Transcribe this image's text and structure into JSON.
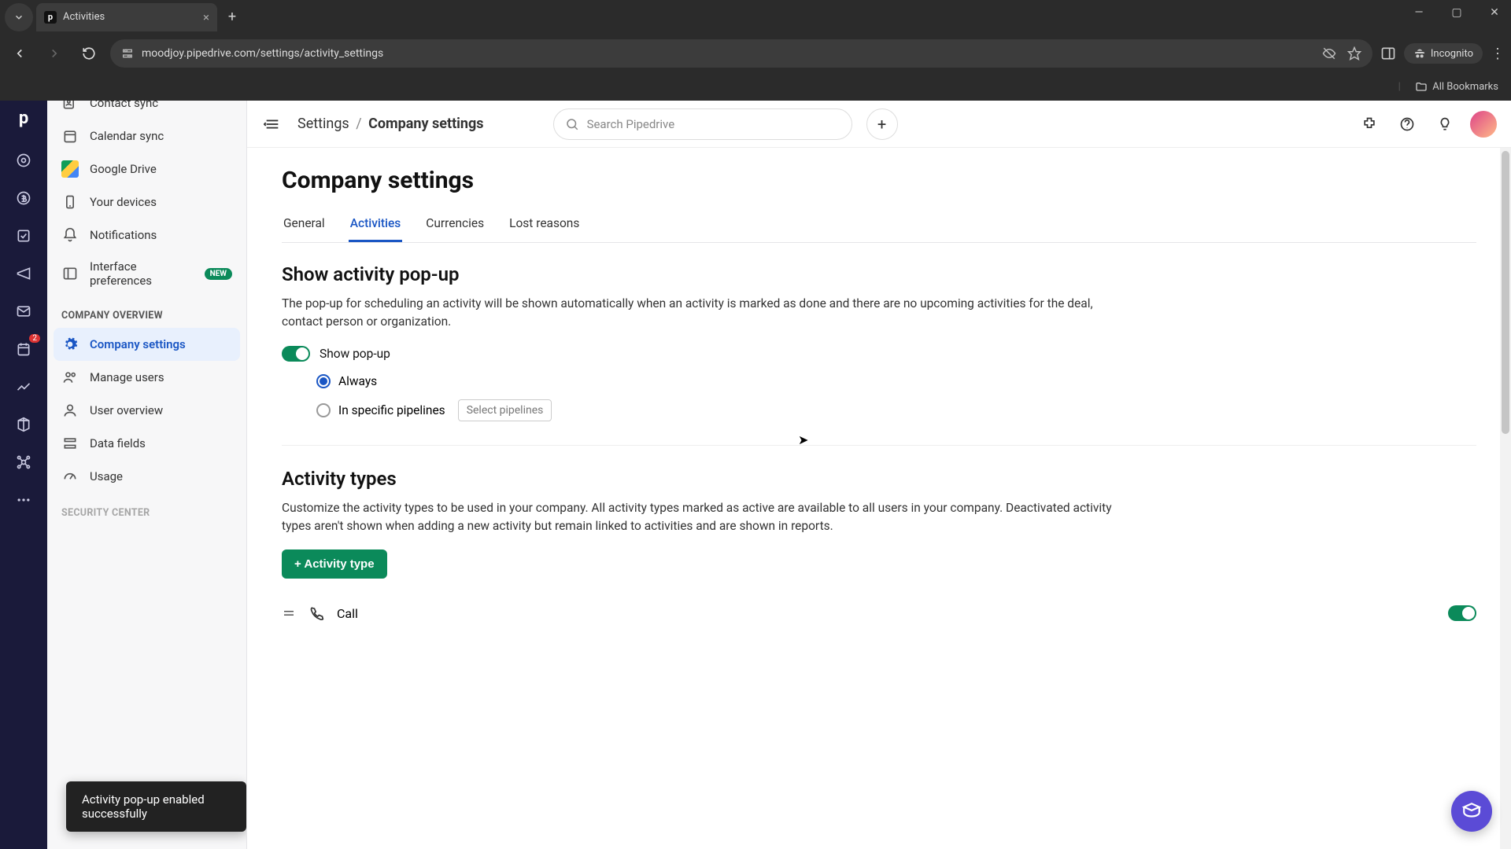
{
  "browser": {
    "tab_title": "Activities",
    "url": "moodjoy.pipedrive.com/settings/activity_settings",
    "incognito_label": "Incognito",
    "bookmarks_label": "All Bookmarks"
  },
  "topbar": {
    "crumb_root": "Settings",
    "crumb_current": "Company settings",
    "search_placeholder": "Search Pipedrive"
  },
  "rail": {
    "badge": "2"
  },
  "sidebar": {
    "items_top": [
      {
        "label": "Contact sync"
      },
      {
        "label": "Calendar sync"
      },
      {
        "label": "Google Drive"
      },
      {
        "label": "Your devices"
      },
      {
        "label": "Notifications"
      },
      {
        "label": "Interface preferences",
        "badge": "NEW"
      }
    ],
    "heading1": "COMPANY OVERVIEW",
    "items_co": [
      {
        "label": "Company settings",
        "active": true
      },
      {
        "label": "Manage users"
      },
      {
        "label": "User overview"
      },
      {
        "label": "Data fields"
      },
      {
        "label": "Usage"
      }
    ],
    "heading2": "SECURITY CENTER"
  },
  "page": {
    "title": "Company settings",
    "tabs": [
      "General",
      "Activities",
      "Currencies",
      "Lost reasons"
    ],
    "active_tab": "Activities",
    "section1": {
      "title": "Show activity pop-up",
      "desc": "The pop-up for scheduling an activity will be shown automatically when an activity is marked as done and there are no upcoming activities for the deal, contact person or organization.",
      "toggle_label": "Show pop-up",
      "radio1": "Always",
      "radio2": "In specific pipelines",
      "select_pipelines": "Select pipelines"
    },
    "section2": {
      "title": "Activity types",
      "desc": "Customize the activity types to be used in your company. All activity types marked as active are available to all users in your company. Deactivated activity types aren't shown when adding a new activity but remain linked to activities and are shown in reports.",
      "add_button": "+ Activity type",
      "row1": "Call"
    }
  },
  "toast": "Activity pop-up enabled successfully"
}
